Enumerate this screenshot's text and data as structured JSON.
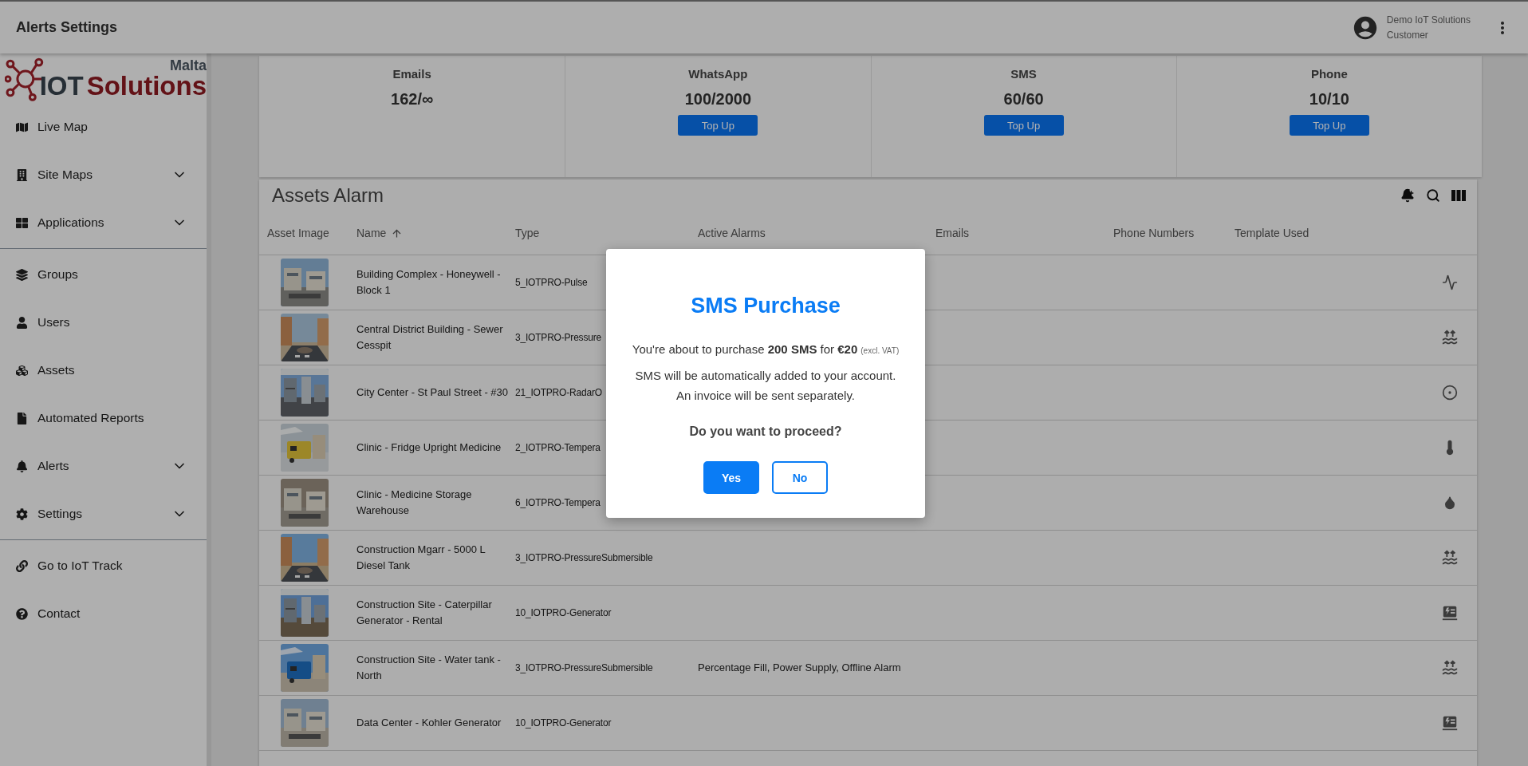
{
  "header": {
    "title": "Alerts Settings",
    "user": {
      "name": "Demo IoT Solutions",
      "role": "Customer"
    }
  },
  "sidebar": {
    "logo": {
      "brand_1": "IOT",
      "brand_2": "Solutions",
      "region": "Malta"
    },
    "groups": [
      [
        {
          "label": "Live Map",
          "expandable": false
        },
        {
          "label": "Site Maps",
          "expandable": true
        },
        {
          "label": "Applications",
          "expandable": true
        }
      ],
      [
        {
          "label": "Groups",
          "expandable": false
        },
        {
          "label": "Users",
          "expandable": false
        },
        {
          "label": "Assets",
          "expandable": false
        },
        {
          "label": "Automated Reports",
          "expandable": false
        },
        {
          "label": "Alerts",
          "expandable": true
        },
        {
          "label": "Settings",
          "expandable": true
        }
      ],
      [
        {
          "label": "Go to IoT Track",
          "expandable": false
        },
        {
          "label": "Contact",
          "expandable": false
        }
      ]
    ]
  },
  "credits": [
    {
      "label": "Emails",
      "value": "162/∞"
    },
    {
      "label": "WhatsApp",
      "value": "100/2000",
      "button": "Top Up"
    },
    {
      "label": "SMS",
      "value": "60/60",
      "button": "Top Up"
    },
    {
      "label": "Phone",
      "value": "10/10",
      "button": "Top Up"
    }
  ],
  "assets_alarm": {
    "title": "Assets Alarm",
    "columns": [
      {
        "label": "Asset Image"
      },
      {
        "label": "Name",
        "sorted": true
      },
      {
        "label": "Type"
      },
      {
        "label": "Active Alarms"
      },
      {
        "label": "Emails"
      },
      {
        "label": "Phone Numbers"
      },
      {
        "label": "Template Used"
      }
    ],
    "rows": [
      {
        "name": "Building Complex - Honeywell - Block 1",
        "type": "5_IOTPRO-Pulse"
      },
      {
        "name": "Central District Building - Sewer Cesspit",
        "type": "3_IOTPRO-Pressure"
      },
      {
        "name": "City Center - St Paul Street - #30",
        "type": "21_IOTPRO-RadarO"
      },
      {
        "name": "Clinic - Fridge Upright Medicine",
        "type": "2_IOTPRO-Tempera"
      },
      {
        "name": "Clinic - Medicine Storage Warehouse",
        "type": "6_IOTPRO-Tempera"
      },
      {
        "name": "Construction Mgarr - 5000 L Diesel Tank",
        "type": "3_IOTPRO-PressureSubmersible"
      },
      {
        "name": "Construction Site - Caterpillar Generator - Rental",
        "type": "10_IOTPRO-Generator"
      },
      {
        "name": "Construction Site - Water tank - North",
        "type": "3_IOTPRO-PressureSubmersible",
        "active_alarms": "Percentage Fill, Power Supply, Offline Alarm"
      },
      {
        "name": "Data Center - Kohler Generator",
        "type": "10_IOTPRO-Generator"
      }
    ]
  },
  "dialog": {
    "title": "SMS Purchase",
    "message": "You're about to purchase **200 SMS** for **€20**",
    "note": "(excl. VAT)",
    "info_1": "SMS will be automatically added to your account.",
    "info_2": "An invoice will be sent separately.",
    "question": "Do you want to proceed?",
    "confirm": "Yes",
    "cancel": "No"
  }
}
